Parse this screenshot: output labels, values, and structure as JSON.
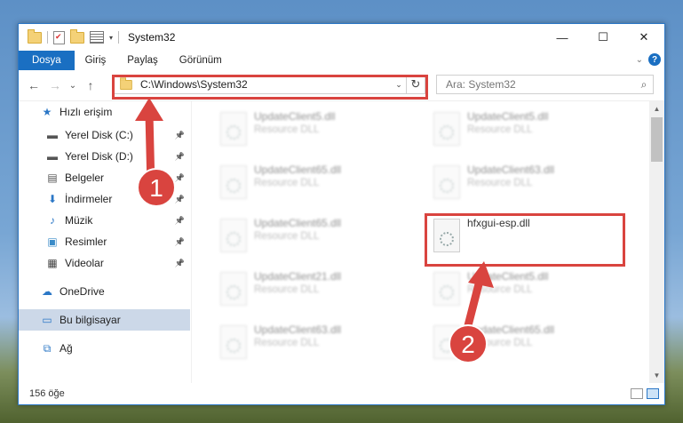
{
  "window": {
    "title": "System32"
  },
  "title_buttons": {
    "minimize": "—",
    "maximize": "☐",
    "close": "✕"
  },
  "ribbon": {
    "tabs": [
      "Dosya",
      "Giriş",
      "Paylaş",
      "Görünüm"
    ],
    "help": "?"
  },
  "address": {
    "path": "C:\\Windows\\System32",
    "refresh_glyph": "↻"
  },
  "search": {
    "placeholder": "Ara: System32",
    "icon": "search-icon"
  },
  "nav_glyphs": {
    "back": "←",
    "forward": "→",
    "recent": "⌄",
    "up": "↑"
  },
  "sidebar": {
    "items": [
      {
        "label": "Hızlı erişim",
        "icon": "star-icon",
        "pinned": false
      },
      {
        "label": "Yerel Disk (C:)",
        "icon": "drive-icon",
        "pinned": true
      },
      {
        "label": "Yerel Disk (D:)",
        "icon": "drive-icon",
        "pinned": true
      },
      {
        "label": "Belgeler",
        "icon": "document-icon",
        "pinned": true
      },
      {
        "label": "İndirmeler",
        "icon": "download-icon",
        "pinned": true
      },
      {
        "label": "Müzik",
        "icon": "music-icon",
        "pinned": true
      },
      {
        "label": "Resimler",
        "icon": "pictures-icon",
        "pinned": true
      },
      {
        "label": "Videolar",
        "icon": "video-icon",
        "pinned": true
      },
      {
        "label": "OneDrive",
        "icon": "cloud-icon",
        "pinned": false
      },
      {
        "label": "Bu bilgisayar",
        "icon": "computer-icon",
        "pinned": false,
        "selected": true
      },
      {
        "label": "Ağ",
        "icon": "network-icon",
        "pinned": false
      }
    ]
  },
  "files": [
    {
      "name": "UpdateClient5.dll",
      "desc": "Resource DLL"
    },
    {
      "name": "UpdateClient5.dll",
      "desc": "Resource DLL"
    },
    {
      "name": "UpdateClient65.dll",
      "desc": "Resource DLL"
    },
    {
      "name": "UpdateClient63.dll",
      "desc": "Resource DLL"
    },
    {
      "name": "UpdateClient65.dll",
      "desc": "Resource DLL"
    },
    {
      "name": "hfxgui-esp.dll",
      "desc": ""
    },
    {
      "name": "UpdateClient21.dll",
      "desc": "Resource DLL"
    },
    {
      "name": "UpdateClient5.dll",
      "desc": "Resource DLL"
    },
    {
      "name": "UpdateClient63.dll",
      "desc": "Resource DLL"
    },
    {
      "name": "UpdateClient65.dll",
      "desc": "Resource DLL"
    }
  ],
  "status": {
    "count": "156 öğe"
  },
  "annotations": {
    "step1": "1",
    "step2": "2"
  },
  "colors": {
    "accent": "#1a6fc2",
    "highlight": "#d9443f",
    "marker": "#d9443f"
  }
}
